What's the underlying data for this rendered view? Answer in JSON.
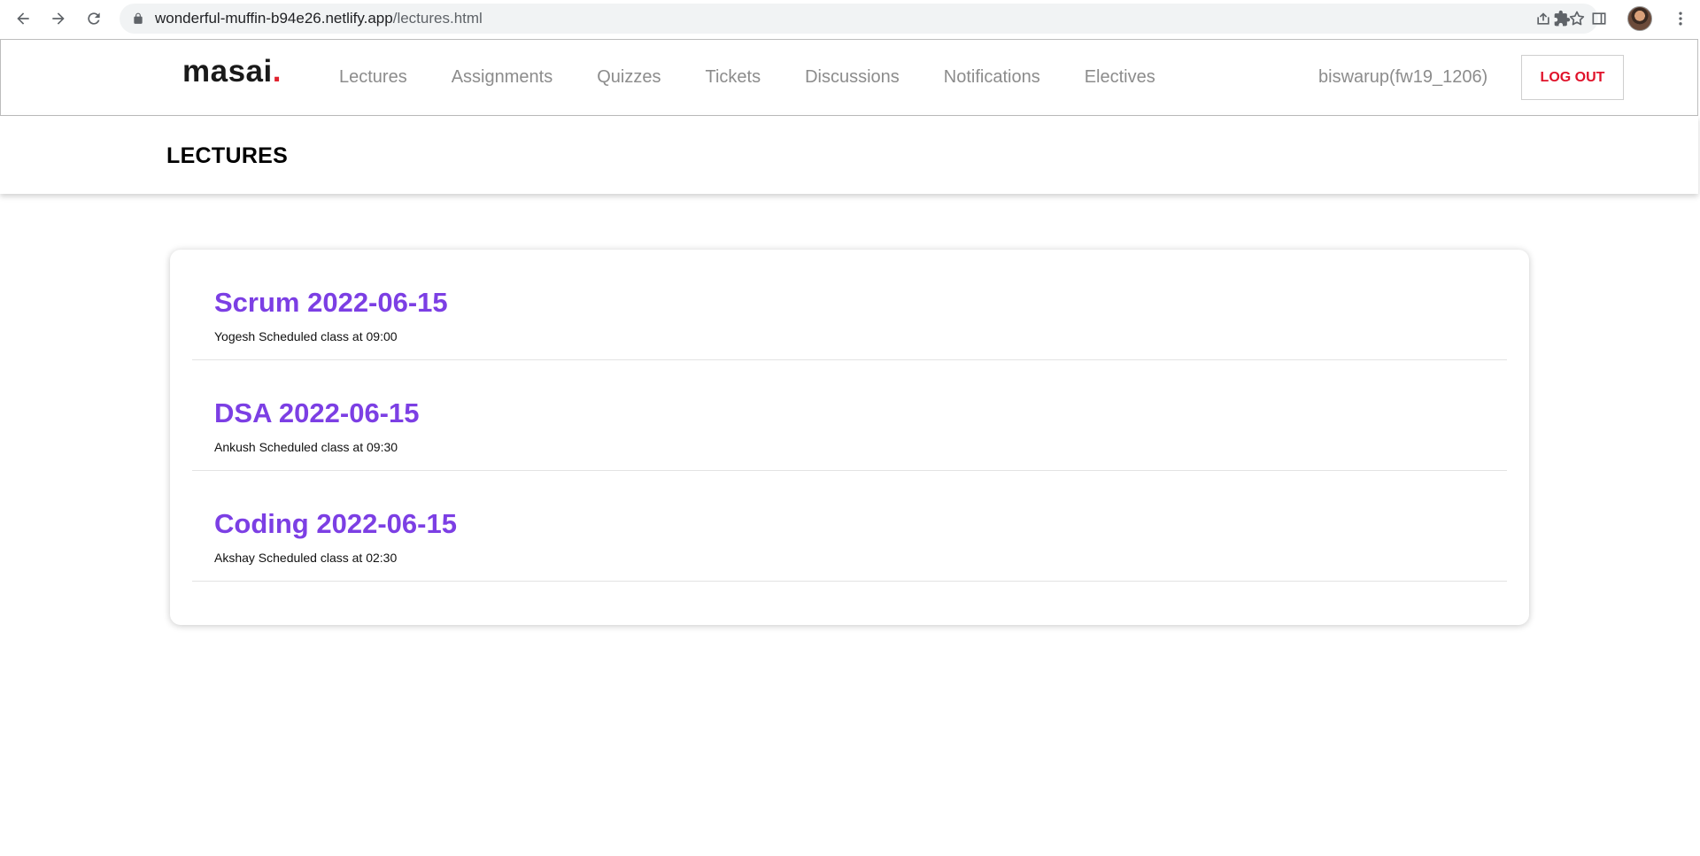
{
  "browser": {
    "url_host": "wonderful-muffin-b94e26.netlify.app",
    "url_path": "/lectures.html"
  },
  "site": {
    "logo_text": "masai",
    "logo_dot": ".",
    "nav": [
      {
        "label": "Lectures"
      },
      {
        "label": "Assignments"
      },
      {
        "label": "Quizzes"
      },
      {
        "label": "Tickets"
      },
      {
        "label": "Discussions"
      },
      {
        "label": "Notifications"
      },
      {
        "label": "Electives"
      }
    ],
    "username": "biswarup(fw19_1206)",
    "logout_label": "LOG OUT",
    "accent_color": "#7c3fe4",
    "logout_color": "#e0122a"
  },
  "page": {
    "title": "LECTURES"
  },
  "lectures": [
    {
      "title": "Scrum 2022-06-15",
      "subtitle": "Yogesh Scheduled class at 09:00"
    },
    {
      "title": "DSA 2022-06-15",
      "subtitle": "Ankush Scheduled class at 09:30"
    },
    {
      "title": "Coding 2022-06-15",
      "subtitle": "Akshay Scheduled class at 02:30"
    }
  ]
}
